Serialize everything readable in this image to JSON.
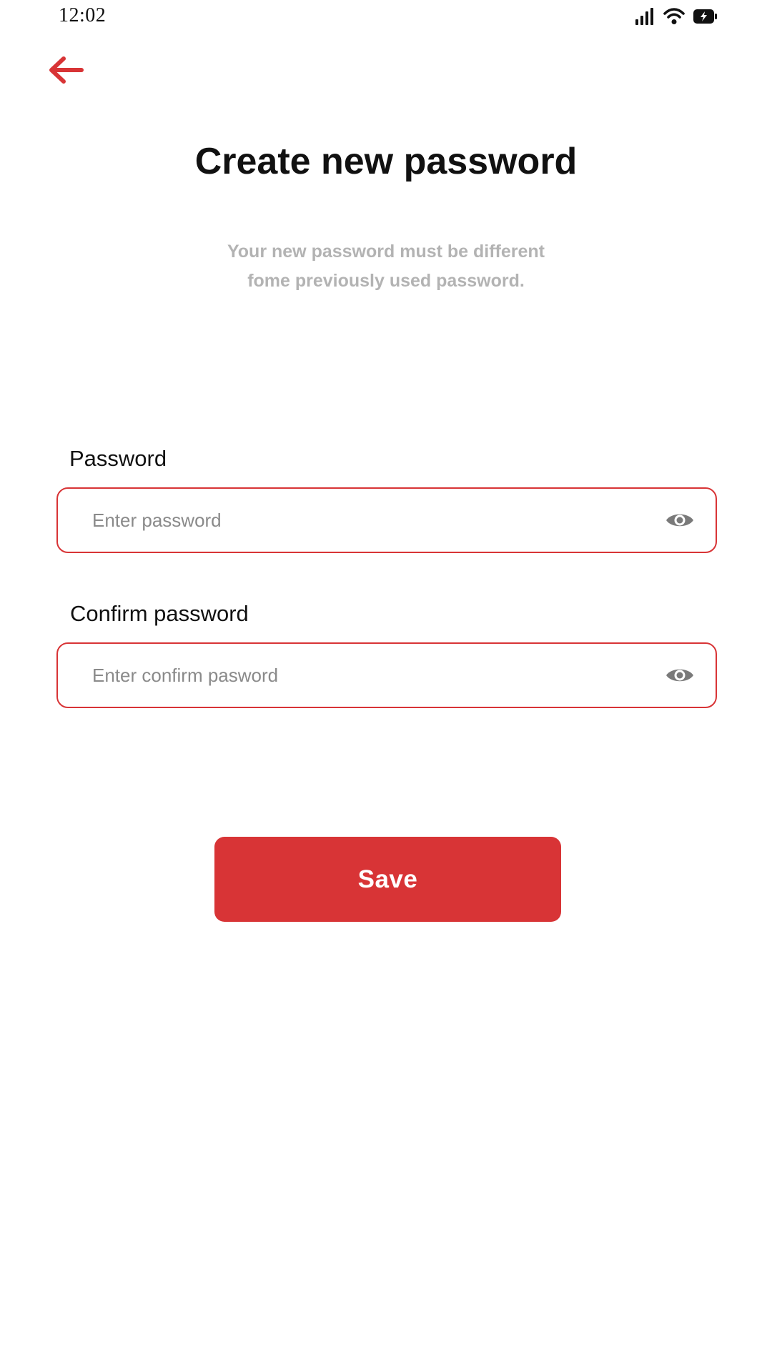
{
  "status_bar": {
    "time": "12:02",
    "icons": [
      "signal-icon",
      "wifi-icon",
      "battery-charging-icon"
    ]
  },
  "header": {
    "back_icon": "arrow-left-icon",
    "title": "Create new password",
    "subtitle_line1": "Your new password must be different",
    "subtitle_line2": "fome previously used password."
  },
  "form": {
    "password": {
      "label": "Password",
      "placeholder": "Enter password",
      "value": "",
      "toggle_icon": "eye-icon"
    },
    "confirm_password": {
      "label": "Confirm password",
      "placeholder": "Enter confirm pasword",
      "value": "",
      "toggle_icon": "eye-icon"
    },
    "save_label": "Save"
  },
  "colors": {
    "accent": "#d83436",
    "subtitle": "#b3b3b3",
    "placeholder": "#8a8a8a",
    "eye_icon": "#7a7a7a"
  }
}
